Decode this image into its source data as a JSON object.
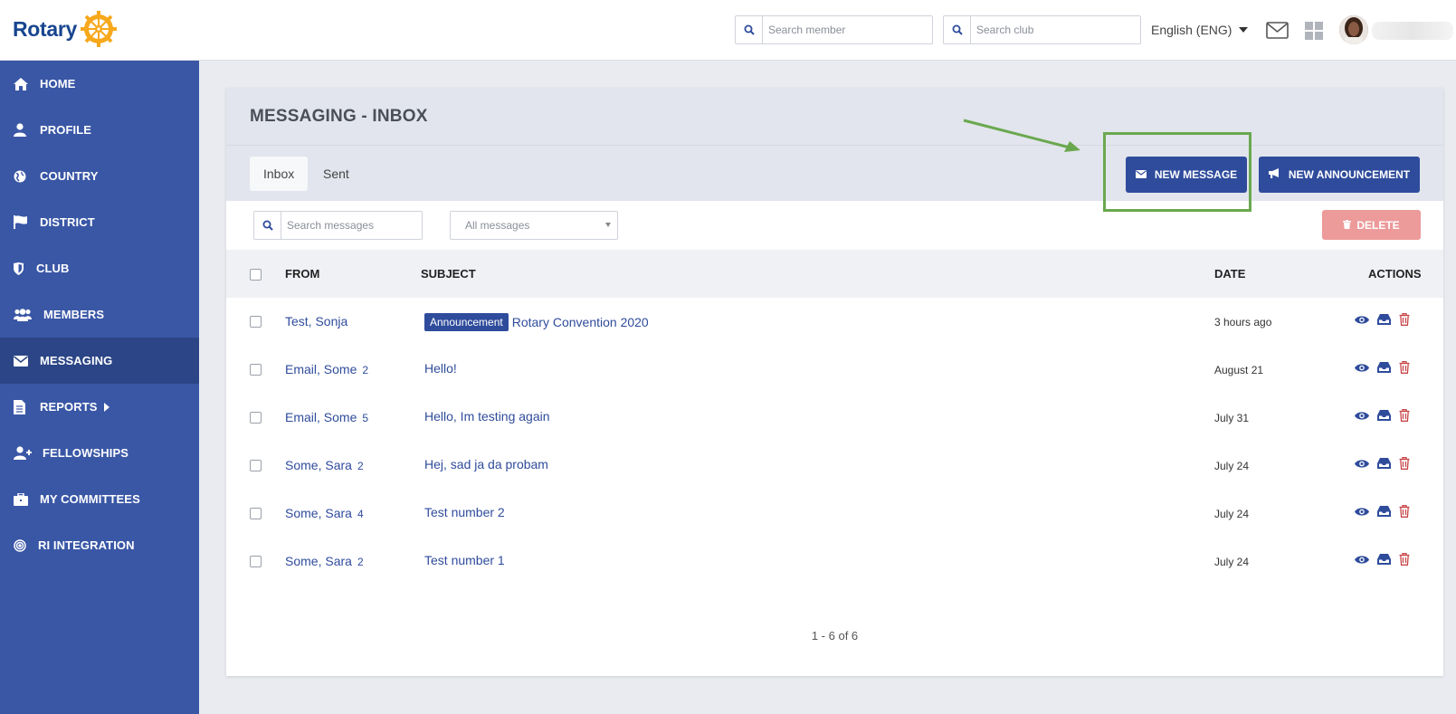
{
  "brand": {
    "name": "Rotary",
    "wheel_color": "#f7a81b",
    "brand_color": "#17458f"
  },
  "header": {
    "search_member_placeholder": "Search member",
    "search_club_placeholder": "Search club",
    "language": "English (ENG)"
  },
  "sidebar": {
    "items": [
      {
        "label": "HOME",
        "icon": "home-icon"
      },
      {
        "label": "PROFILE",
        "icon": "user-icon"
      },
      {
        "label": "COUNTRY",
        "icon": "globe-icon"
      },
      {
        "label": "DISTRICT",
        "icon": "flag-icon"
      },
      {
        "label": "CLUB",
        "icon": "shield-icon"
      },
      {
        "label": "MEMBERS",
        "icon": "users-icon"
      },
      {
        "label": "MESSAGING",
        "icon": "envelope-icon",
        "active": true
      },
      {
        "label": "REPORTS",
        "icon": "file-icon"
      },
      {
        "label": "FELLOWSHIPS",
        "icon": "user-plus-icon"
      },
      {
        "label": "MY COMMITTEES",
        "icon": "briefcase-icon"
      },
      {
        "label": "RI INTEGRATION",
        "icon": "target-icon"
      }
    ]
  },
  "page": {
    "title": "MESSAGING - INBOX",
    "tabs": [
      "Inbox",
      "Sent"
    ],
    "new_message_label": "NEW MESSAGE",
    "new_announcement_label": "NEW ANNOUNCEMENT",
    "search_messages_placeholder": "Search messages",
    "filter_selected": "All messages",
    "delete_label": "DELETE"
  },
  "table": {
    "headers": {
      "from": "FROM",
      "subject": "SUBJECT",
      "date": "DATE",
      "actions": "ACTIONS"
    },
    "rows": [
      {
        "from": "Test, Sonja",
        "count": "",
        "badge": "Announcement",
        "subject": "Rotary Convention 2020",
        "date": "3 hours ago"
      },
      {
        "from": "Email, Some",
        "count": "2",
        "badge": "",
        "subject": "Hello!",
        "date": "August 21"
      },
      {
        "from": "Email, Some",
        "count": "5",
        "badge": "",
        "subject": "Hello, Im testing again",
        "date": "July 31"
      },
      {
        "from": "Some, Sara",
        "count": "2",
        "badge": "",
        "subject": "Hej, sad ja da probam",
        "date": "July 24"
      },
      {
        "from": "Some, Sara",
        "count": "4",
        "badge": "",
        "subject": "Test number 2",
        "date": "July 24"
      },
      {
        "from": "Some, Sara",
        "count": "2",
        "badge": "",
        "subject": "Test number 1",
        "date": "July 24"
      }
    ]
  },
  "pagination": "1 - 6 of 6",
  "colors": {
    "sidebar": "#3a57a6",
    "sidebar_active": "#2b4586",
    "primary": "#2f4c9c",
    "delete": "#ec9a9a",
    "annotation": "#6aa84f"
  }
}
